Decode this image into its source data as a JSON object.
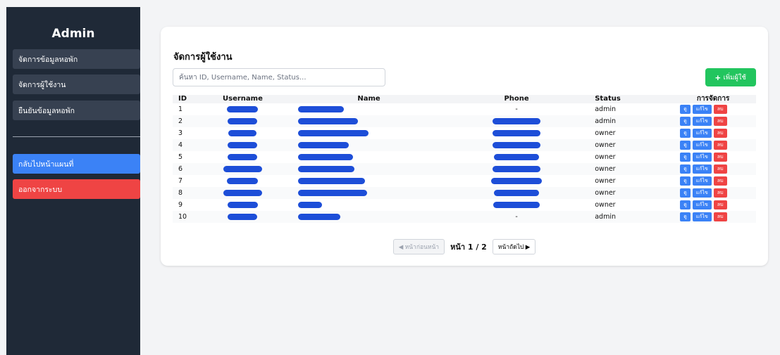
{
  "sidebar": {
    "title": "Admin",
    "items": [
      {
        "label": "จัดการข้อมูลหอพัก"
      },
      {
        "label": "จัดการผู้ใช้งาน"
      },
      {
        "label": "ยืนยันข้อมูลหอพัก"
      }
    ],
    "back_label": "กลับไปหน้าแผนที่",
    "logout_label": "ออกจากระบบ"
  },
  "main": {
    "title": "จัดการผู้ใช้งาน",
    "search_placeholder": "ค้นหา ID, Username, Name, Status...",
    "add_label": "เพิ่มผู้ใช้",
    "add_icon": "+",
    "columns": [
      "ID",
      "Username",
      "Name",
      "Phone",
      "Status",
      "การจัดการ"
    ],
    "actions": {
      "view": "ดู",
      "edit": "แก้ไข",
      "delete": "ลบ"
    },
    "rows": [
      {
        "id": "1",
        "phone": "-",
        "status": "admin"
      },
      {
        "id": "2",
        "phone": "",
        "status": "admin"
      },
      {
        "id": "3",
        "phone": "",
        "status": "owner"
      },
      {
        "id": "4",
        "phone": "",
        "status": "owner"
      },
      {
        "id": "5",
        "phone": "",
        "status": "owner"
      },
      {
        "id": "6",
        "phone": "",
        "status": "owner"
      },
      {
        "id": "7",
        "phone": "",
        "status": "owner"
      },
      {
        "id": "8",
        "phone": "",
        "status": "owner"
      },
      {
        "id": "9",
        "phone": "",
        "status": "owner"
      },
      {
        "id": "10",
        "phone": "-",
        "status": "admin"
      }
    ],
    "pager": {
      "prev_label": "◀ หน้าก่อนหน้า",
      "info": "หน้า 1 / 2",
      "next_label": "หน้าถัดไป ▶"
    }
  },
  "colors": {
    "sidebar": "#1f2937",
    "accent_blue": "#3b82f6",
    "danger": "#ef4444",
    "success": "#22c55e",
    "redaction": "#1d4ed8"
  }
}
